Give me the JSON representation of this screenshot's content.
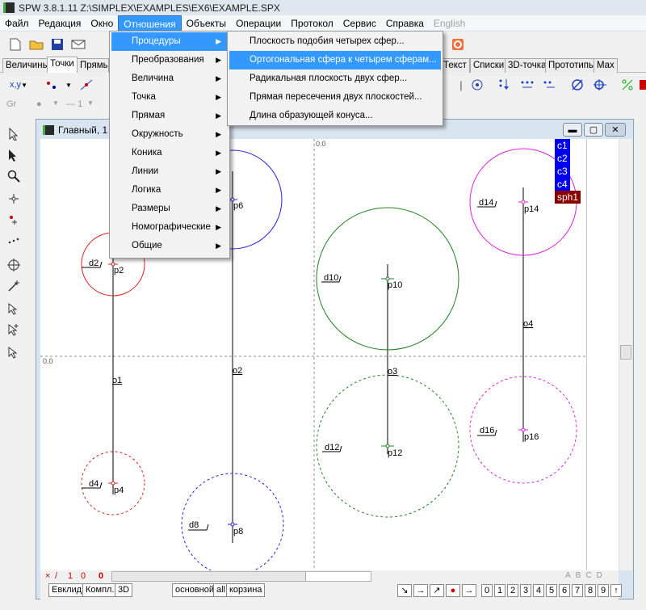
{
  "window": {
    "title": "SPW 3.8.1.11 Z:\\SIMPLEX\\EXAMPLES\\EX6\\EXAMPLE.SPX"
  },
  "menubar": {
    "items": [
      "Файл",
      "Редакция",
      "Окно",
      "Отношения",
      "Объекты",
      "Операции",
      "Протокол",
      "Сервис",
      "Справка",
      "English"
    ]
  },
  "tabs": {
    "items": [
      "Величины",
      "Точки",
      "Прямые",
      "Текст",
      "Списки",
      "3D-точка",
      "Прототипы",
      "Max"
    ]
  },
  "toolbar2": {
    "xy_label": "x,y"
  },
  "toolbar3": {
    "gr_label": "Gr",
    "one_label": "1"
  },
  "mdi": {
    "title": "Главный, 1"
  },
  "canvas": {
    "origin_top": "0.0",
    "origin_left": "0.0",
    "labels": {
      "p2": "p2",
      "d2": "d2",
      "p6": "p6",
      "d10": "d10",
      "p10": "p10",
      "d14": "d14",
      "p14": "p14",
      "o4": "o4",
      "o1": "o1",
      "o2": "o2",
      "o3": "o3",
      "d12": "d12",
      "p12": "p12",
      "d16": "d16",
      "p16": "p16",
      "d4": "d4",
      "p4": "p4",
      "d8": "d8",
      "p8": "p8"
    }
  },
  "legend": {
    "items": [
      "c1",
      "c2",
      "c3",
      "c4"
    ],
    "special": "sph1",
    "blue": "#0000ee",
    "red": "#880000"
  },
  "menu_relations": {
    "items": [
      "Процедуры",
      "Преобразования",
      "Величина",
      "Точка",
      "Прямая",
      "Окружность",
      "Коника",
      "Линии",
      "Логика",
      "Размеры",
      "Номографические",
      "Общие"
    ]
  },
  "menu_procedures": {
    "items": [
      "Плоскость подобия четырех сфер...",
      "Ортогональная сфера к четырем сферам...",
      "Радикальная плоскость двух сфер...",
      "Прямая пересечения двух плоскостей...",
      "Длина образующей конуса..."
    ]
  },
  "bottom": {
    "tabs": [
      "Евклид",
      "Компл.",
      "3D",
      "основной",
      "all",
      "корзина"
    ],
    "counter": [
      "×",
      "/",
      "1",
      "0",
      "0"
    ],
    "digits": [
      "0",
      "1",
      "2",
      "3",
      "4",
      "5",
      "6",
      "7",
      "8",
      "9",
      "↑"
    ],
    "letters": [
      "A",
      "B",
      "C",
      "D"
    ]
  }
}
